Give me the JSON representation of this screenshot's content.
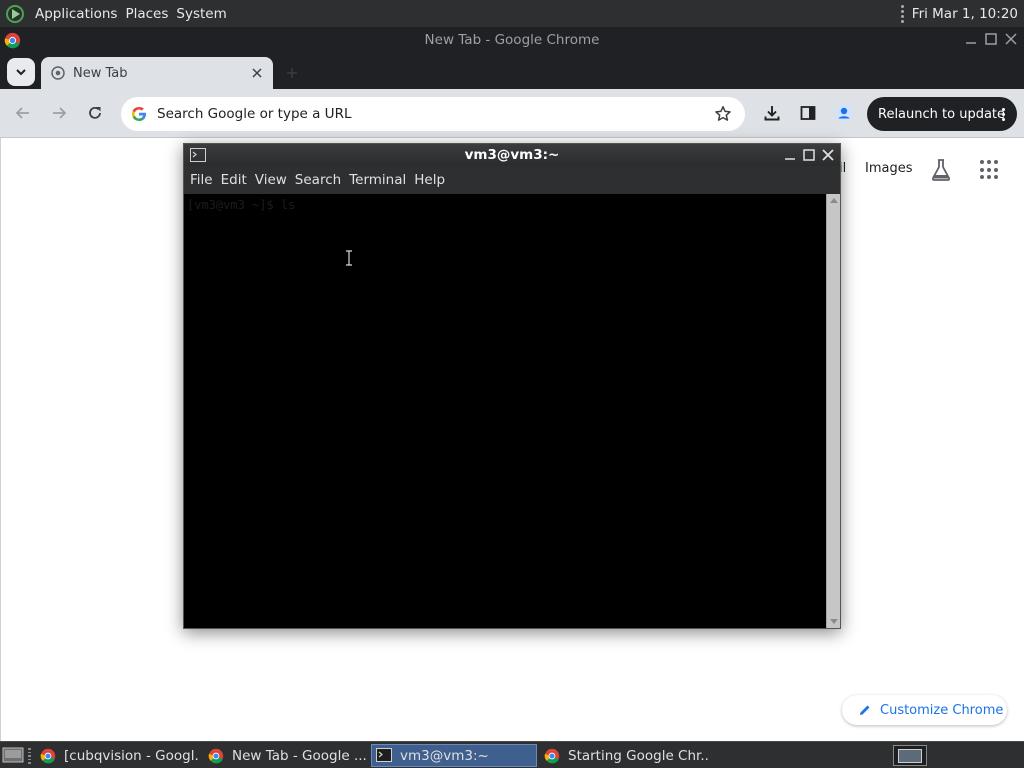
{
  "top_panel": {
    "menus": [
      "Applications",
      "Places",
      "System"
    ],
    "clock": "Fri Mar  1, 10:20"
  },
  "chrome": {
    "window_title": "New Tab - Google Chrome",
    "tab": {
      "label": "New Tab"
    },
    "omnibox": {
      "placeholder": "Search Google or type a URL",
      "value": ""
    },
    "relaunch_label": "Relaunch to update",
    "ntp": {
      "gmail_label": "il",
      "images_label": "Images",
      "customize_label": "Customize Chrome"
    }
  },
  "terminal": {
    "title": "vm3@vm3:~",
    "menus": [
      "File",
      "Edit",
      "View",
      "Search",
      "Terminal",
      "Help"
    ],
    "prompt_text": "[vm3@vm3 ~]$ ls"
  },
  "taskbar": {
    "tasks": [
      {
        "label": "[cubqvision - Googl...",
        "icon": "chrome-icon",
        "active": false
      },
      {
        "label": "New Tab - Google ...",
        "icon": "chrome-icon",
        "active": false
      },
      {
        "label": "vm3@vm3:~",
        "icon": "terminal-icon",
        "active": true
      },
      {
        "label": "Starting Google Chr...",
        "icon": "chrome-icon",
        "active": false
      }
    ]
  },
  "colors": {
    "panel_bg": "#2d2f31",
    "chrome_frame": "#202124",
    "chrome_toolbar": "#dee1e6",
    "accent_blue": "#1a73e8",
    "terminal_bg": "#000000",
    "task_active": "#3f5f8f"
  }
}
